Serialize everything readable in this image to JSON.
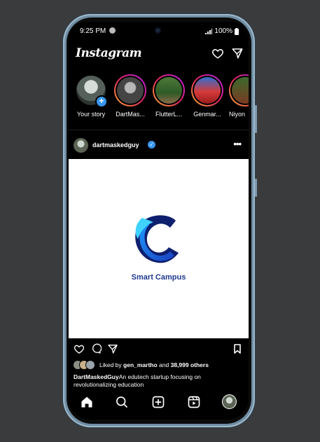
{
  "status": {
    "time": "9:25 PM",
    "battery": "100%"
  },
  "header": {
    "logo": "Instagram"
  },
  "stories": [
    {
      "label": "Your story"
    },
    {
      "label": "DartMas..."
    },
    {
      "label": "FlutterL..."
    },
    {
      "label": "Genmar..."
    },
    {
      "label": "Niyon"
    }
  ],
  "post": {
    "username": "dartmaskedguy",
    "image_title": "Smart Campus",
    "liked_by_prefix": "Liked by ",
    "liked_by_user": "gen_martho",
    "liked_by_mid": " and ",
    "liked_by_count": "38,999 others",
    "caption_user": "DartMaskedGuy",
    "caption_text": "An edutech startup focusing on revolutionalizing education"
  },
  "colors": {
    "accent": "#3897f0",
    "brand": "#1f3a8f",
    "background": "#3a3b3d"
  },
  "icons": [
    "heart-icon",
    "send-icon",
    "comment-icon",
    "share-icon",
    "bookmark-icon",
    "home-icon",
    "search-icon",
    "add-post-icon",
    "reels-icon"
  ]
}
